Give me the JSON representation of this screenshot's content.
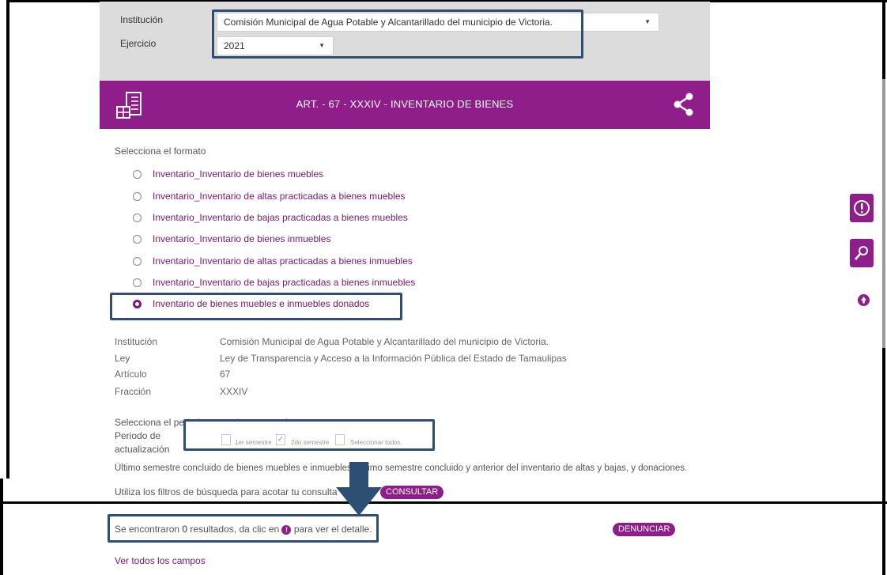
{
  "filters": {
    "institucion_label": "Institución",
    "institucion_value": "Comisión Municipal de Agua Potable y Alcantarillado del municipio de Victoria.",
    "ejercicio_label": "Ejercicio",
    "ejercicio_value": "2021"
  },
  "header": {
    "title": "ART. - 67 - XXXIV - INVENTARIO DE BIENES",
    "icon": "inventory-icon",
    "share_icon": "share-icon"
  },
  "formato": {
    "label": "Selecciona el formato",
    "options": [
      "Inventario_Inventario de bienes muebles",
      "Inventario_Inventario de altas practicadas a bienes muebles",
      "Inventario_Inventario de bajas practicadas a bienes muebles",
      "Inventario_Inventario de bienes inmuebles",
      "Inventario_Inventario de altas practicadas a bienes inmuebles",
      "Inventario_Inventario de bajas practicadas a bienes inmuebles",
      "Inventario de bienes muebles e inmuebles donados"
    ],
    "selected_index": 6
  },
  "info": {
    "institucion_label": "Institución",
    "institucion_value": "Comisión Municipal de Agua Potable y Alcantarillado del municipio de Victoria.",
    "ley_label": "Ley",
    "ley_value": "Ley de Transparencia y Acceso a la Información Pública del Estado de Tamaulipas",
    "articulo_label": "Artículo",
    "articulo_value": "67",
    "fraccion_label": "Fracción",
    "fraccion_value": "XXXIV"
  },
  "periodo": {
    "prompt": "Selecciona el periodo que quieres consultar",
    "label_line1": "Periodo de",
    "label_line2": "actualización",
    "options": [
      {
        "label": "1er semestre",
        "checked": false
      },
      {
        "label": "2do semestre",
        "checked": true
      },
      {
        "label": "Seleccionar todos",
        "checked": false
      }
    ],
    "note": "Último semestre concluido de bienes muebles e inmuebles. Último semestre concluido y anterior del inventario de altas y bajas, y donaciones."
  },
  "search": {
    "hint": "Utiliza los filtros de búsqueda para acotar tu consulta",
    "consultar": "CONSULTAR"
  },
  "results": {
    "prefix": "Se encontraron ",
    "count": "0",
    "middle": " resultados, da clic en ",
    "suffix": " para ver el detalle.",
    "denunciar": "DENUNCIAR",
    "ver_todos": "Ver todos los campos"
  },
  "colors": {
    "purple": "#8f1e8b",
    "highlight": "#2e4f74"
  }
}
